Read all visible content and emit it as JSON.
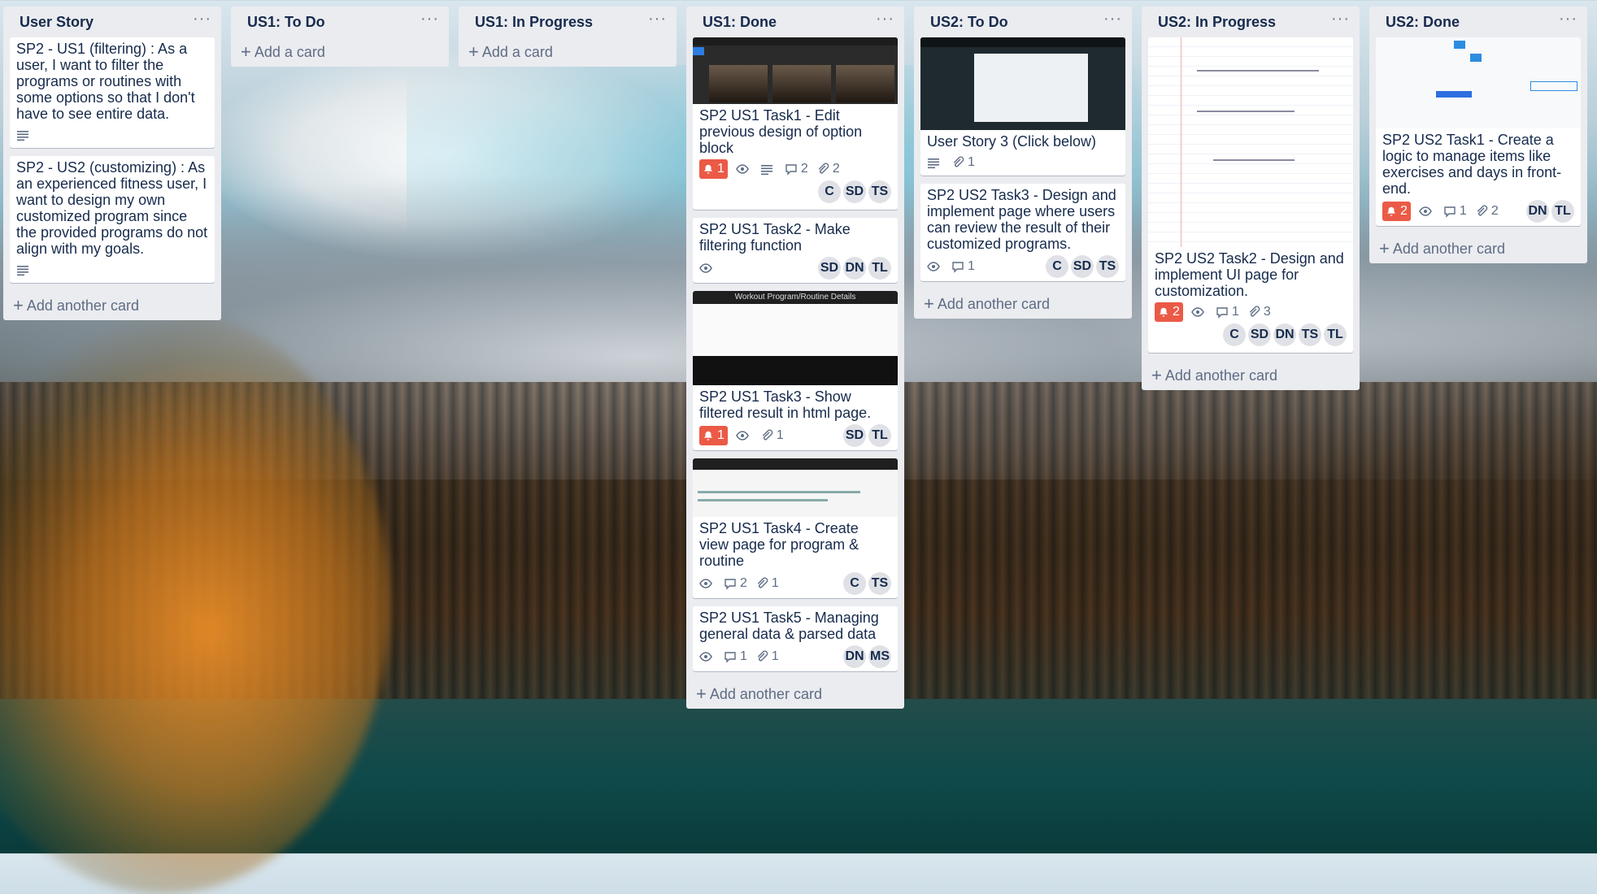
{
  "labels": {
    "add_another_card": "Add another card",
    "add_a_card": "Add a card",
    "menu": "···"
  },
  "lists": [
    {
      "title": "User Story",
      "cards": [
        {
          "title": "SP2 - US1 (filtering) : As a user, I want to filter the programs or routines with some options so that I don't have to see entire data."
        },
        {
          "title": "SP2 - US2 (customizing) : As an experienced fitness user, I want to design my own customized program since the provided programs do not align with my goals."
        }
      ]
    },
    {
      "title": "US1: To Do"
    },
    {
      "title": "US1: In Progress"
    },
    {
      "title": "US1: Done",
      "cards": [
        {
          "title": "SP2 US1 Task1 - Edit previous design of option block",
          "due": "1",
          "comments": "2",
          "attachments": "2",
          "members": [
            "C",
            "SD",
            "TS"
          ]
        },
        {
          "title": "SP2 US1 Task2 - Make filtering function",
          "members": [
            "SD",
            "DN",
            "TL"
          ]
        },
        {
          "title": "SP2 US1 Task3 - Show filtered result in html page.",
          "due": "1",
          "attachments": "1",
          "members": [
            "SD",
            "TL"
          ],
          "cover_caption": "Workout Program/Routine Details"
        },
        {
          "title": "SP2 US1 Task4 - Create view page for program & routine",
          "comments": "2",
          "attachments": "1",
          "members": [
            "C",
            "TS"
          ]
        },
        {
          "title": "SP2 US1 Task5 - Managing general data & parsed data",
          "comments": "1",
          "attachments": "1",
          "members": [
            "DN",
            "MS"
          ]
        }
      ]
    },
    {
      "title": "US2: To Do",
      "cards": [
        {
          "title": "User Story 3 (Click below)",
          "attachments": "1"
        },
        {
          "title": "SP2 US2 Task3 - Design and implement page where users can review the result of their customized programs.",
          "comments": "1",
          "members": [
            "C",
            "SD",
            "TS"
          ]
        }
      ]
    },
    {
      "title": "US2: In Progress",
      "cards": [
        {
          "title": "SP2 US2 Task2 - Design and implement UI page for customization.",
          "due": "2",
          "comments": "1",
          "attachments": "3",
          "members": [
            "C",
            "SD",
            "DN",
            "TS",
            "TL"
          ]
        }
      ]
    },
    {
      "title": "US2: Done",
      "cards": [
        {
          "title": "SP2 US2 Task1 - Create a logic to manage items like exercises and days in front-end.",
          "due": "2",
          "comments": "1",
          "attachments": "2",
          "members": [
            "DN",
            "TL"
          ]
        }
      ]
    }
  ]
}
